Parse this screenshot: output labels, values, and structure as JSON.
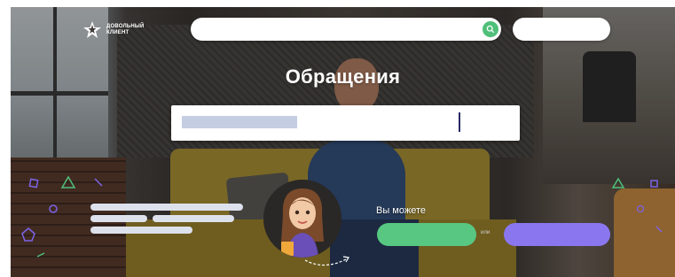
{
  "header": {
    "logo_text": "ДОВОЛЬНЫЙ\nКЛИЕНТ",
    "search": {
      "value": "",
      "placeholder": ""
    },
    "login_label": ""
  },
  "main": {
    "title": "Обращения",
    "input": {
      "value": "",
      "placeholder": ""
    }
  },
  "actions": {
    "prompt": "Вы можете",
    "separator": "или",
    "primary_label": "",
    "secondary_label": ""
  },
  "colors": {
    "accent_green": "#57c781",
    "accent_violet": "#8a77f0",
    "search_button": "#4fbf7a"
  },
  "icons": {
    "logo": "star-logo-icon",
    "search": "search-icon",
    "decor": "geometric-shapes-icon",
    "avatar": "assistant-avatar-icon",
    "arrow": "curved-arrow-icon"
  }
}
